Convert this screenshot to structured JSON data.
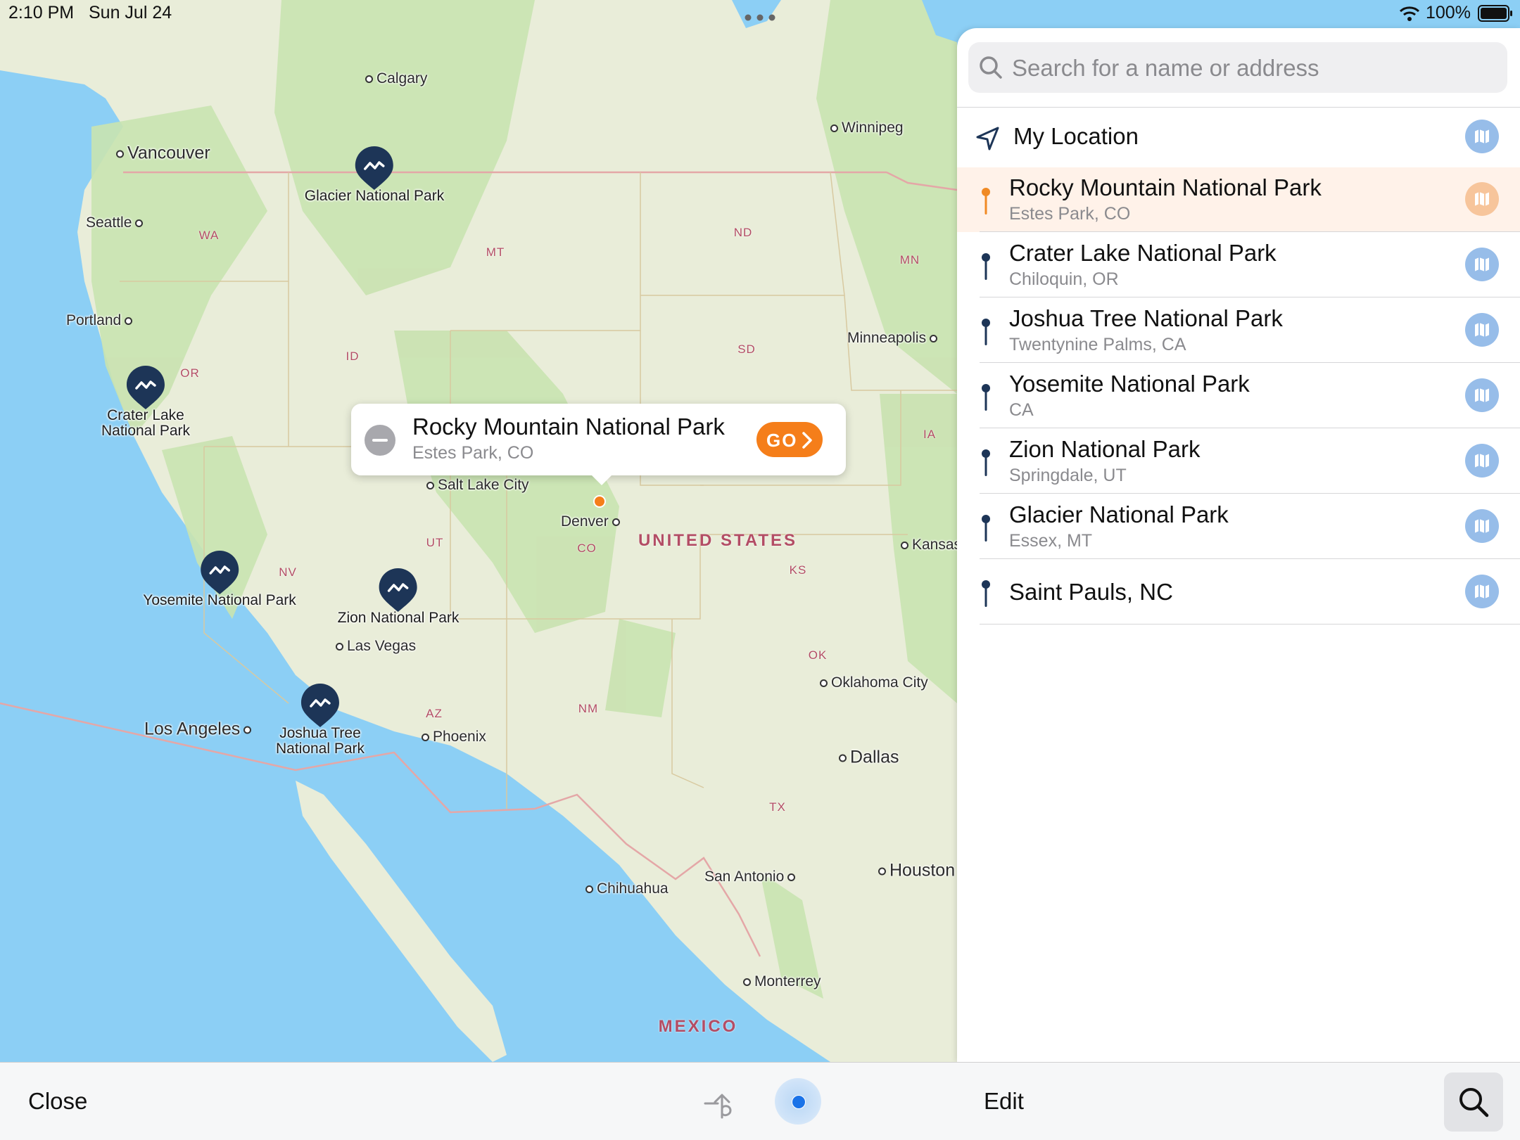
{
  "status_bar": {
    "time": "2:10 PM",
    "date": "Sun Jul 24",
    "battery": "100%"
  },
  "map": {
    "cities": [
      {
        "name": "Calgary",
        "big": false
      },
      {
        "name": "Winnipeg",
        "big": false
      },
      {
        "name": "Vancouver",
        "big": true
      },
      {
        "name": "Seattle",
        "big": false
      },
      {
        "name": "Portland",
        "big": false
      },
      {
        "name": "Minneapolis",
        "big": false
      },
      {
        "name": "Salt Lake City",
        "big": false
      },
      {
        "name": "Denver",
        "big": false
      },
      {
        "name": "Kansas",
        "big": false
      },
      {
        "name": "Las Vegas",
        "big": false
      },
      {
        "name": "Los Angeles",
        "big": true
      },
      {
        "name": "Oklahoma City",
        "big": false
      },
      {
        "name": "Phoenix",
        "big": false
      },
      {
        "name": "Dallas",
        "big": true
      },
      {
        "name": "Houston",
        "big": true
      },
      {
        "name": "San Antonio",
        "big": false
      },
      {
        "name": "Chihuahua",
        "big": false
      },
      {
        "name": "Monterrey",
        "big": false
      }
    ],
    "states": [
      "WA",
      "MT",
      "ND",
      "MN",
      "OR",
      "ID",
      "SD",
      "IA",
      "NV",
      "UT",
      "CO",
      "KS",
      "OK",
      "AZ",
      "NM",
      "TX"
    ],
    "countries": [
      "UNITED STATES",
      "MEXICO"
    ],
    "parks": [
      {
        "name": "Glacier National Park"
      },
      {
        "name": "Crater Lake\nNational Park"
      },
      {
        "name": "Yosemite National Park"
      },
      {
        "name": "Zion National Park"
      },
      {
        "name": "Joshua Tree\nNational Park"
      }
    ],
    "callout": {
      "title": "Rocky Mountain National Park",
      "subtitle": "Estes Park, CO",
      "go_label": "GO"
    }
  },
  "panel": {
    "search_placeholder": "Search for a name or address",
    "my_location": "My Location",
    "places": [
      {
        "name": "Rocky Mountain National Park",
        "address": "Estes Park, CO",
        "selected": true
      },
      {
        "name": "Crater Lake National Park",
        "address": "Chiloquin, OR",
        "selected": false
      },
      {
        "name": "Joshua Tree National Park",
        "address": "Twentynine Palms, CA",
        "selected": false
      },
      {
        "name": "Yosemite National Park",
        "address": "CA",
        "selected": false
      },
      {
        "name": "Zion National Park",
        "address": "Springdale, UT",
        "selected": false
      },
      {
        "name": "Glacier National Park",
        "address": "Essex, MT",
        "selected": false
      },
      {
        "name": "Saint Pauls, NC",
        "address": "",
        "selected": false
      }
    ]
  },
  "toolbar": {
    "close_label": "Close",
    "edit_label": "Edit"
  },
  "colors": {
    "accent": "#f57e1a",
    "pin": "#1d3557",
    "map_button": "#97bde9",
    "water": "#8ccff5",
    "land": "#e8eddd"
  }
}
